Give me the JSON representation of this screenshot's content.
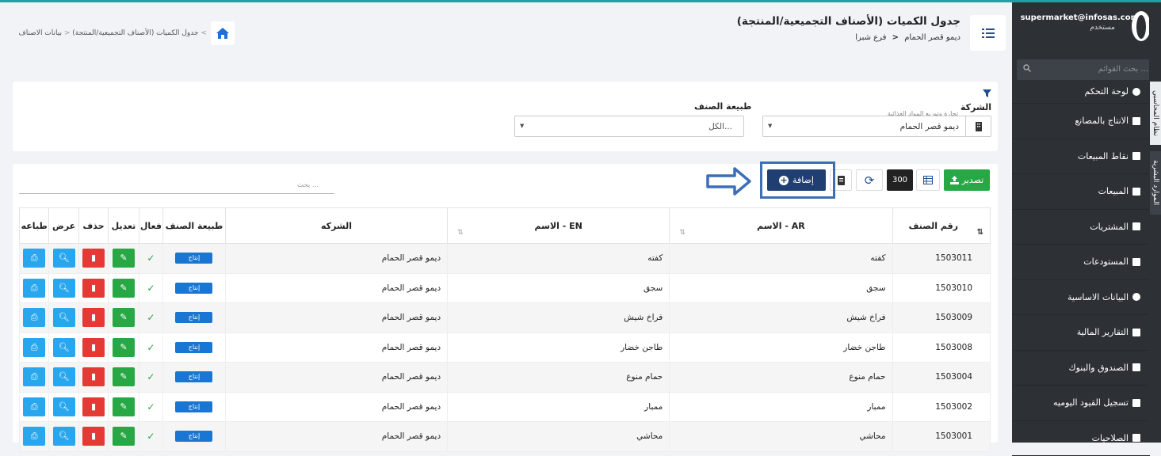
{
  "user": {
    "email": "supermarket@infosas.com",
    "role": "مستخدم"
  },
  "sidebar": {
    "search_placeholder": "بحث القوائم ...",
    "items": [
      {
        "label": "لوحة التحكم",
        "icon": "info-icon"
      },
      {
        "label": "الانتاج بالمصانع",
        "icon": "chart-icon"
      },
      {
        "label": "نقاط المبيعات",
        "icon": "database-icon"
      },
      {
        "label": "المبيعات",
        "icon": "truck-icon"
      },
      {
        "label": "المشتريات",
        "icon": "card-icon"
      },
      {
        "label": "المستودعات",
        "icon": "archive-icon"
      },
      {
        "label": "البيانات الاساسية",
        "icon": "info-icon"
      },
      {
        "label": "التقارير المالية",
        "icon": "file-icon"
      },
      {
        "label": "الصندوق والبنوك",
        "icon": "card-icon"
      },
      {
        "label": "تسجيل القيود اليوميه",
        "icon": "file-icon"
      },
      {
        "label": "الصلاحيات",
        "icon": "users-icon"
      }
    ],
    "vertical_tabs": [
      "نظام المحاسبي",
      "الموارد البشرية"
    ]
  },
  "header": {
    "title": "جدول الكميات (الأصناف التجميعية/المنتجة)",
    "subtitle_company": "ديمو قصر الحمام",
    "subtitle_branch": "فرع شبرا",
    "breadcrumb": [
      "بيانات الاصناف",
      "جدول الكميات (الأصناف التجميعية/المنتجة)"
    ]
  },
  "filter": {
    "company_label": "الشركة",
    "company_hint": "تجارة وتوزيع المواد الغذائية",
    "company_value": "ديمو قصر الحمام",
    "type_label": "طبيعة الصنف",
    "type_value": "الكل..."
  },
  "toolbar": {
    "export_label": "تصدير",
    "page_size": "300",
    "add_label": "إضافة",
    "search_placeholder": "بحث ..."
  },
  "table": {
    "columns": [
      "رقم الصنف",
      "الاسم - AR",
      "الاسم - EN",
      "الشركه",
      "طبيعة الصنف",
      "فعال",
      "تعديل",
      "حذف",
      "عرض",
      "طباعه"
    ],
    "rows": [
      {
        "code": "1503011",
        "name_ar": "كفته",
        "name_en": "كفته",
        "company": "ديمو قصر الحمام",
        "type": "إنتاج"
      },
      {
        "code": "1503010",
        "name_ar": "سجق",
        "name_en": "سجق",
        "company": "ديمو قصر الحمام",
        "type": "إنتاج"
      },
      {
        "code": "1503009",
        "name_ar": "فراخ شيش",
        "name_en": "فراخ شيش",
        "company": "ديمو قصر الحمام",
        "type": "إنتاج"
      },
      {
        "code": "1503008",
        "name_ar": "طاجن خضار",
        "name_en": "طاجن خضار",
        "company": "ديمو قصر الحمام",
        "type": "إنتاج"
      },
      {
        "code": "1503004",
        "name_ar": "حمام منوع",
        "name_en": "حمام منوع",
        "company": "ديمو قصر الحمام",
        "type": "إنتاج"
      },
      {
        "code": "1503002",
        "name_ar": "ممبار",
        "name_en": "ممبار",
        "company": "ديمو قصر الحمام",
        "type": "إنتاج"
      },
      {
        "code": "1503001",
        "name_ar": "محاشي",
        "name_en": "محاشي",
        "company": "ديمو قصر الحمام",
        "type": "إنتاج"
      }
    ]
  },
  "colors": {
    "sidebar": "#2d3136",
    "primary": "#1f3f73",
    "success": "#28a745",
    "danger": "#e53935",
    "info": "#29a7ee",
    "badge": "#1976d2"
  }
}
